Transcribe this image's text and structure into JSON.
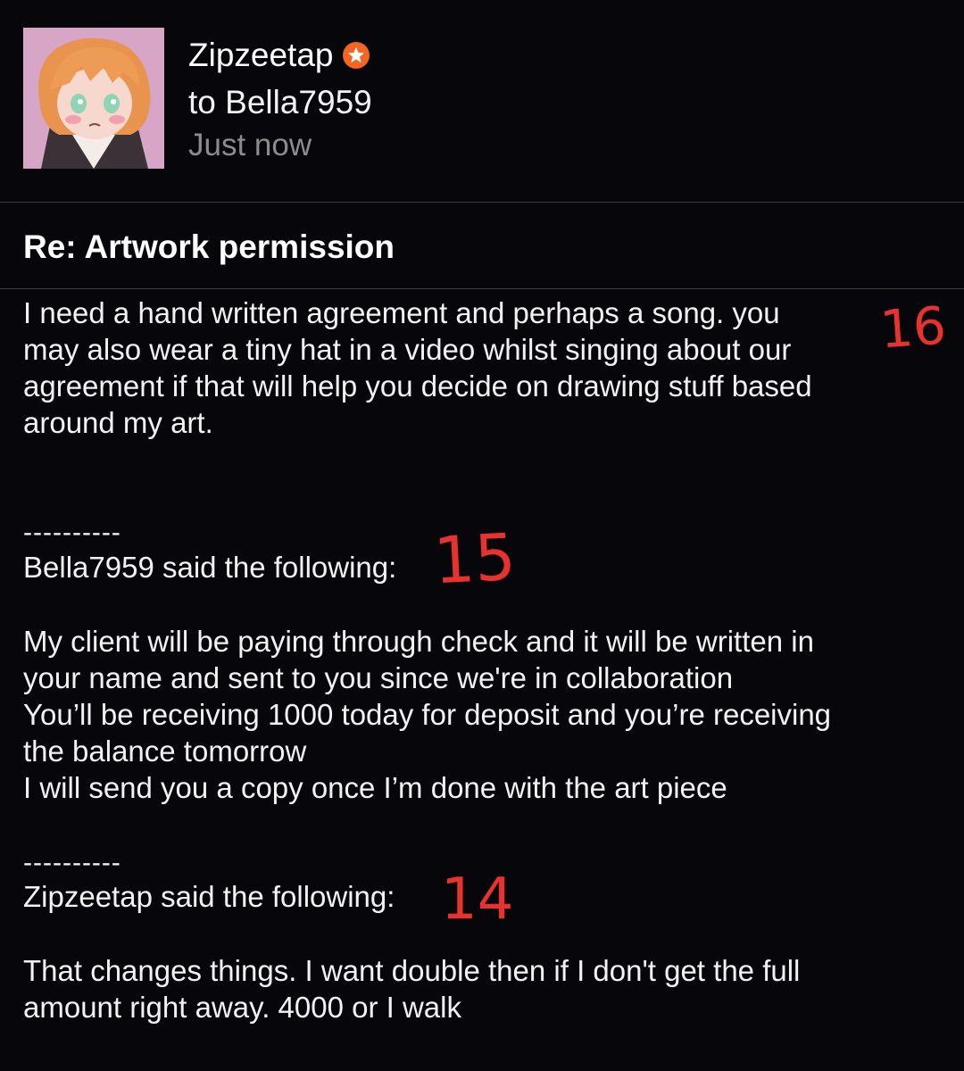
{
  "header": {
    "sender": "Zipzeetap",
    "recipient": "to Bella7959",
    "timestamp": "Just now",
    "badge_icon": "star-badge-icon",
    "badge_color": "#f26522"
  },
  "message": {
    "subject": "Re: Artwork permission",
    "reply_body": "I need a hand written agreement and perhaps a song. you\nmay also wear a tiny hat in a video whilst singing about our\nagreement if that will help you decide on drawing stuff based\naround my art.",
    "quotes": [
      {
        "separator": "----------",
        "attribution": "Bella7959 said the following:",
        "body": "My client will be paying through check and it will be written in\nyour name and sent to you since we're in collaboration\nYou’ll be receiving 1000 today for deposit and you’re receiving\nthe balance tomorrow\nI will send you a copy once I’m done with the art piece"
      },
      {
        "separator": "----------",
        "attribution": "Zipzeetap said the following:",
        "body": "That changes things. I want double then if I don't get the full\namount right away. 4000 or I walk"
      }
    ]
  },
  "annotations": [
    "16",
    "15",
    "14"
  ],
  "colors": {
    "background": "#07060b",
    "annotation": "#e8322f"
  }
}
